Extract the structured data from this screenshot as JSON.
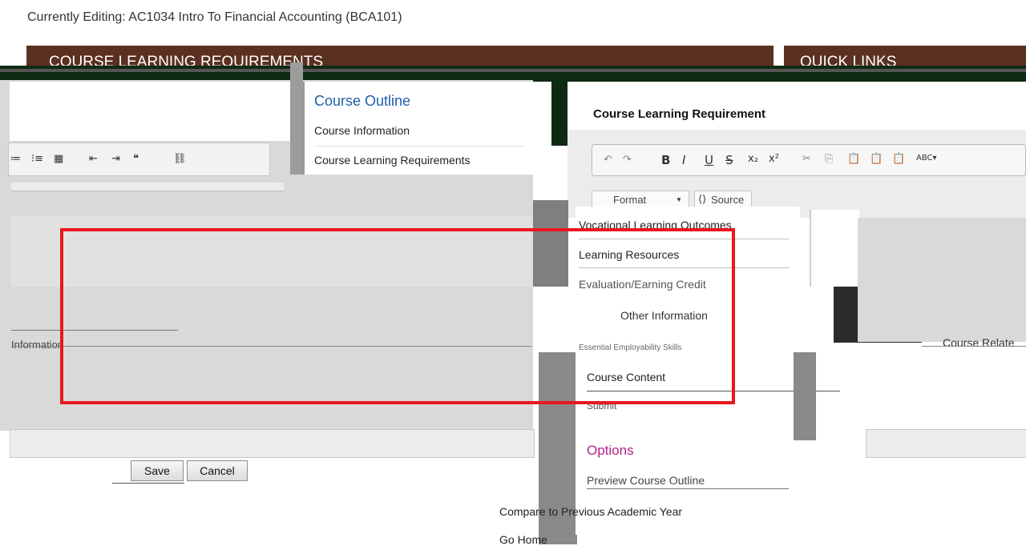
{
  "header": {
    "editing_label": "Currently Editing: AC1034 Intro To Financial Accounting (BCA101)"
  },
  "banners": {
    "left_title": "COURSE LEARNING REQUIREMENTS",
    "right_title": "QUICK LINKS",
    "brand_color": "#5a3020"
  },
  "nav_menu": {
    "heading": "Course Outline",
    "items": [
      "Course Information",
      "Course Learning Requirements"
    ]
  },
  "editor": {
    "section_title": "Course Learning Requirement",
    "format_label": "Format",
    "source_label": "Source",
    "toolbar_right_icons": [
      "B",
      "I",
      "U",
      "S",
      "x₂",
      "x²"
    ],
    "toolbar_left_icons": [
      "≔",
      "⁝≡",
      "▦",
      "⇤",
      "⇥",
      "❝",
      "⛓"
    ]
  },
  "side_menu": {
    "items": [
      "Vocational Learning Outcomes",
      "Learning Resources",
      "Evaluation/Earning Credit",
      "Other Information",
      "Essential Employability Skills",
      "Course Content",
      "Submit"
    ],
    "options_heading": "Options",
    "options_items": [
      "Preview Course Outline",
      "Compare to Previous Academic Year",
      "Go Home"
    ]
  },
  "labels": {
    "information": "Information",
    "course_related": "Course Relate"
  },
  "form_buttons": {
    "save": "Save",
    "cancel": "Cancel"
  },
  "highlight": {
    "color": "#e8181c"
  }
}
